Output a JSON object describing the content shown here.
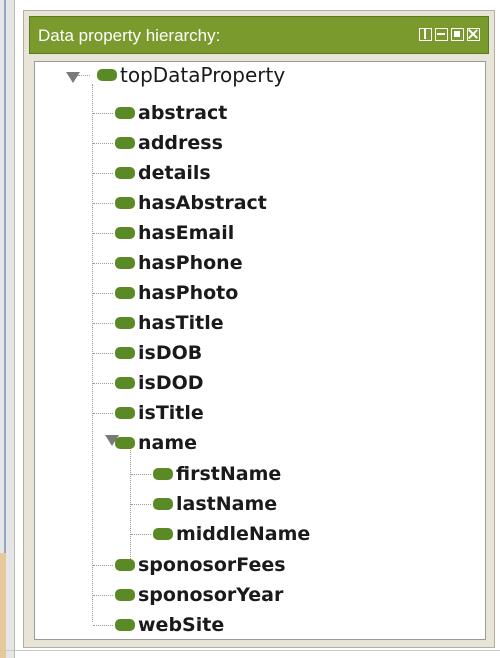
{
  "panel": {
    "title": "Data property hierarchy:",
    "header_color": "#7a9a2e",
    "controls": [
      "split-view-icon",
      "minimize-icon",
      "maximize-icon",
      "close-icon"
    ]
  },
  "tree": {
    "icon_color": "#5a8a26",
    "root": {
      "label": "topDataProperty",
      "expanded": true,
      "children": [
        {
          "label": "abstract"
        },
        {
          "label": "address"
        },
        {
          "label": "details"
        },
        {
          "label": "hasAbstract"
        },
        {
          "label": "hasEmail"
        },
        {
          "label": "hasPhone"
        },
        {
          "label": "hasPhoto"
        },
        {
          "label": "hasTitle"
        },
        {
          "label": "isDOB"
        },
        {
          "label": "isDOD"
        },
        {
          "label": "isTitle"
        },
        {
          "label": "name",
          "expanded": true,
          "children": [
            {
              "label": "firstName"
            },
            {
              "label": "lastName"
            },
            {
              "label": "middleName"
            }
          ]
        },
        {
          "label": "sponosorFees"
        },
        {
          "label": "sponosorYear"
        },
        {
          "label": "webSite"
        }
      ]
    }
  }
}
